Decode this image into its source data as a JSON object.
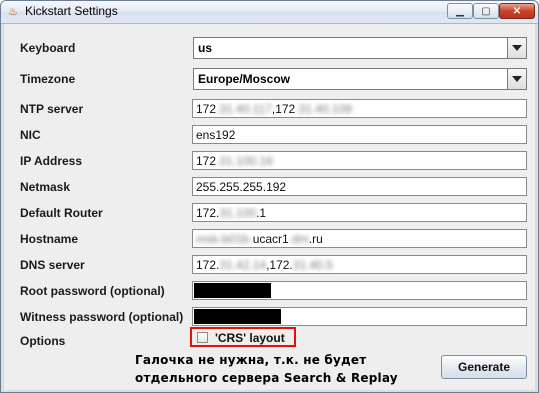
{
  "window": {
    "title": "Kickstart Settings",
    "icon": "java-cup-icon",
    "controls": {
      "minimize": "▁",
      "maximize": "▢",
      "close": "✕"
    }
  },
  "form": {
    "keyboard": {
      "label": "Keyboard",
      "value": "us"
    },
    "timezone": {
      "label": "Timezone",
      "value": "Europe/Moscow"
    },
    "ntp": {
      "label": "NTP server",
      "prefix": "172",
      "hidden1": ".31.40.117",
      "mid": ",172",
      "hidden2": ".31.40.109"
    },
    "nic": {
      "label": "NIC",
      "value": "ens192"
    },
    "ip": {
      "label": "IP Address",
      "prefix": "172",
      "hidden": ".31.100.16"
    },
    "netmask": {
      "label": "Netmask",
      "value": "255.255.255.192"
    },
    "router": {
      "label": "Default Router",
      "prefix": "172.",
      "hidden": "31.100",
      "suffix": ".1"
    },
    "hostname": {
      "label": "Hostname",
      "hidden1": "msk-b01b-",
      "mid": "ucacr1",
      "hidden2": ".dm",
      "suffix": ".ru"
    },
    "dns": {
      "label": "DNS server",
      "prefix": "172.",
      "hidden1": "31.42.14",
      "mid": ",172.",
      "hidden2": "31.40.5"
    },
    "root_password": {
      "label": "Root password (optional)",
      "fill_fraction": 0.23
    },
    "witness_password": {
      "label": "Witness password (optional)",
      "fill_fraction": 0.26
    },
    "options": {
      "label": "Options",
      "checkbox_label": "'CRS' layout",
      "checked": false
    }
  },
  "annotation": {
    "line1": "Галочка не нужна, т.к. не будет",
    "line2": "отдельного сервера Search & Replay",
    "highlight_color": "#e0120c"
  },
  "buttons": {
    "generate": "Generate"
  }
}
